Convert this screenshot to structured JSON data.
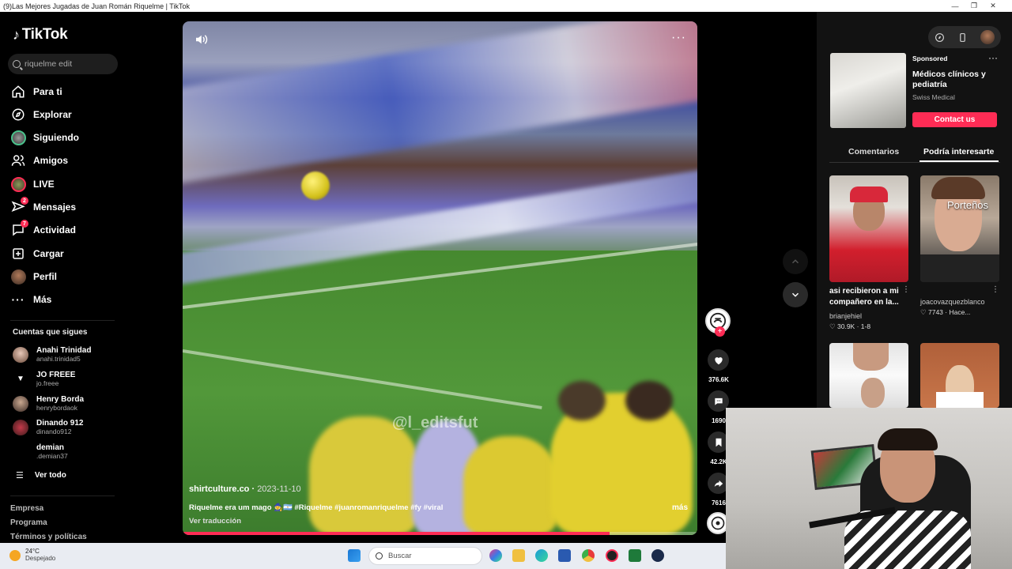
{
  "window": {
    "title": "(9)Las Mejores Jugadas de Juan Román Riquelme | TikTok"
  },
  "brand": {
    "name": "TikTok",
    "accent": "#fe2c55"
  },
  "search": {
    "value": "riquelme edit"
  },
  "nav": [
    {
      "label": "Para ti",
      "icon": "home-icon"
    },
    {
      "label": "Explorar",
      "icon": "compass-icon"
    },
    {
      "label": "Siguiendo",
      "icon": "following-avatar-icon"
    },
    {
      "label": "Amigos",
      "icon": "friends-icon"
    },
    {
      "label": "LIVE",
      "icon": "live-icon"
    },
    {
      "label": "Mensajes",
      "icon": "send-icon",
      "badge": "2"
    },
    {
      "label": "Actividad",
      "icon": "inbox-icon",
      "badge": "7"
    },
    {
      "label": "Cargar",
      "icon": "plus-square-icon"
    },
    {
      "label": "Perfil",
      "icon": "profile-avatar-icon"
    },
    {
      "label": "Más",
      "icon": "more-dots-icon"
    }
  ],
  "following": {
    "title": "Cuentas que sigues",
    "accounts": [
      {
        "name": "Anahi Trinidad",
        "username": "anahi.trinidad5"
      },
      {
        "name": "JO FREEE",
        "username": "jo.freee"
      },
      {
        "name": "Henry Borda",
        "username": "henrybordaok"
      },
      {
        "name": "Dinando 912",
        "username": "dinando912"
      },
      {
        "name": "demian",
        "username": ".demian37"
      }
    ],
    "see_all": "Ver todo"
  },
  "footer": [
    "Empresa",
    "Programa",
    "Términos y políticas"
  ],
  "video": {
    "watermark": "@l_editsfut",
    "author": "shirtculture.co",
    "date": "2023-11-10",
    "caption": "Riquelme era um mago 🧙🇦🇷 #Riquelme #juanromanriquelme #fy #viral",
    "more": "más",
    "translate": "Ver traducción",
    "progress": 0.83
  },
  "actions": {
    "likes": "376.6K",
    "comments": "1690",
    "saves": "42.2K",
    "shares": "7616"
  },
  "ad": {
    "sponsored": "Sponsored",
    "title": "Médicos clínicos y pediatría",
    "advertiser": "Swiss Medical",
    "cta": "Contact us"
  },
  "tabs": {
    "comments": "Comentarios",
    "recommended": "Podría interesarte"
  },
  "cards": [
    {
      "title": "asi recibieron a mi compañero en la...",
      "user": "brianjehiel",
      "likes": "30.9K",
      "extra": "1-8"
    },
    {
      "title": "",
      "user": "joacovazquezblanco",
      "likes": "7743",
      "extra": "Hace...",
      "overlay": "Porteños"
    }
  ],
  "taskbar": {
    "temp": "24°C",
    "weather": "Despejado",
    "search": "Buscar"
  }
}
